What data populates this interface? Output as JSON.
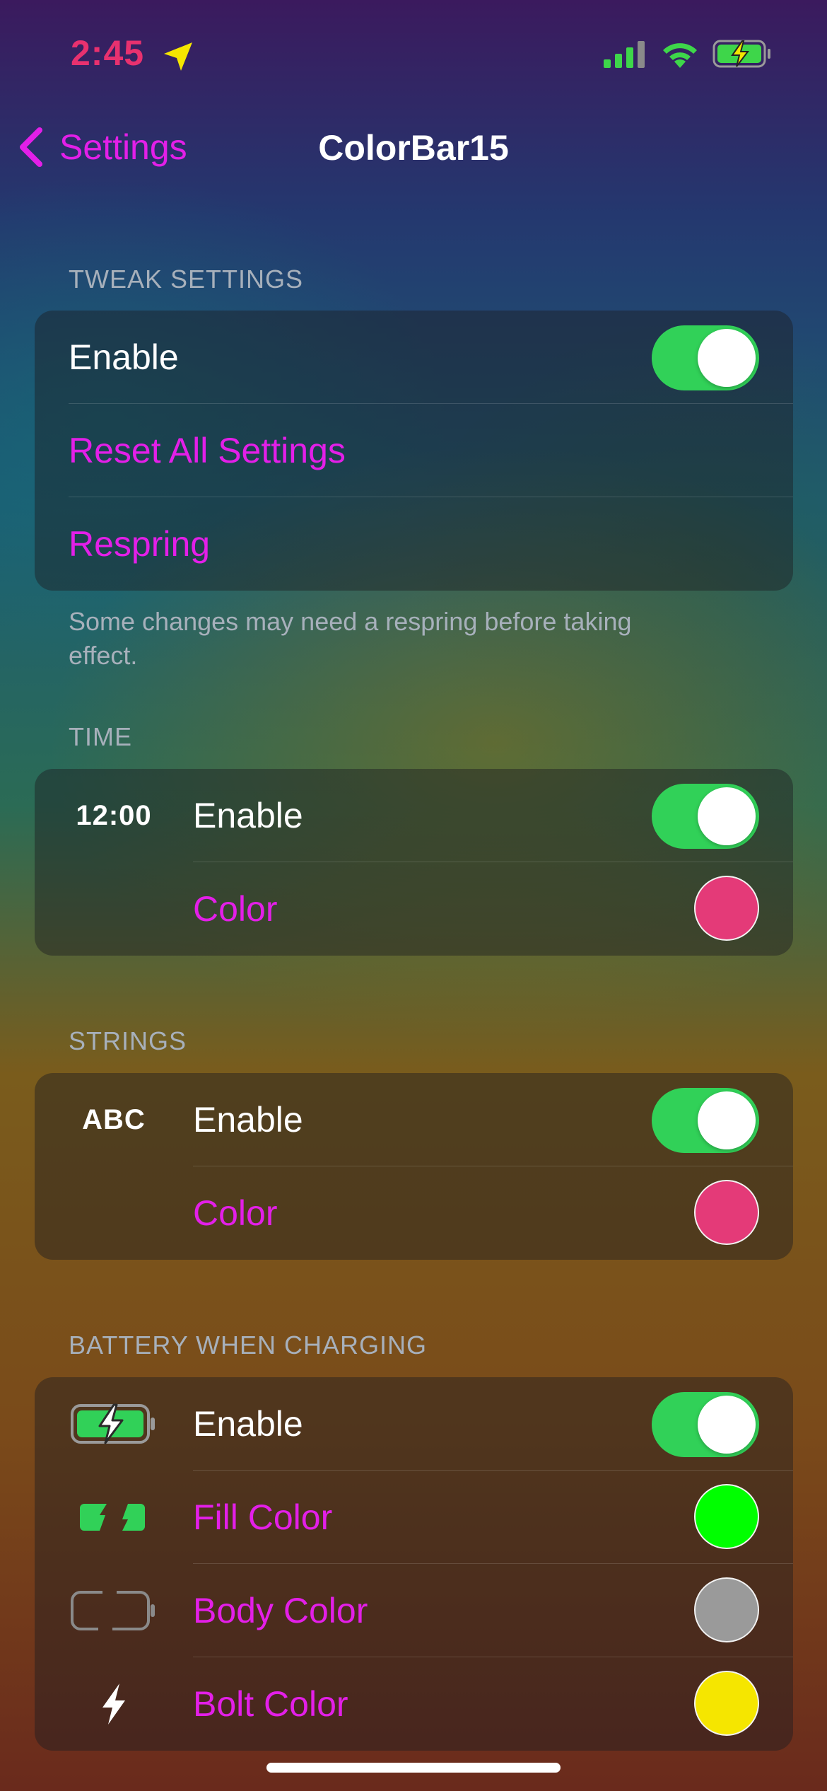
{
  "status_bar": {
    "time": "2:45"
  },
  "nav": {
    "back_label": "Settings",
    "title": "ColorBar15"
  },
  "colors": {
    "accent": "#e31fe8",
    "toggle_on": "#31d158"
  },
  "sections": {
    "tweak": {
      "header": "TWEAK SETTINGS",
      "enable_label": "Enable",
      "enable_on": true,
      "reset_label": "Reset All Settings",
      "respring_label": "Respring",
      "footer": "Some changes may need a respring before taking effect."
    },
    "time": {
      "header": "TIME",
      "icon_text": "12:00",
      "enable_label": "Enable",
      "enable_on": true,
      "color_label": "Color",
      "color_value": "#e43a78"
    },
    "strings": {
      "header": "STRINGS",
      "icon_text": "ABC",
      "enable_label": "Enable",
      "enable_on": true,
      "color_label": "Color",
      "color_value": "#e43a78"
    },
    "battery": {
      "header": "BATTERY WHEN CHARGING",
      "enable_label": "Enable",
      "enable_on": true,
      "fill_label": "Fill Color",
      "fill_value": "#00ff00",
      "body_label": "Body Color",
      "body_value": "#9a9a9a",
      "bolt_label": "Bolt Color",
      "bolt_value": "#f5e600"
    }
  }
}
